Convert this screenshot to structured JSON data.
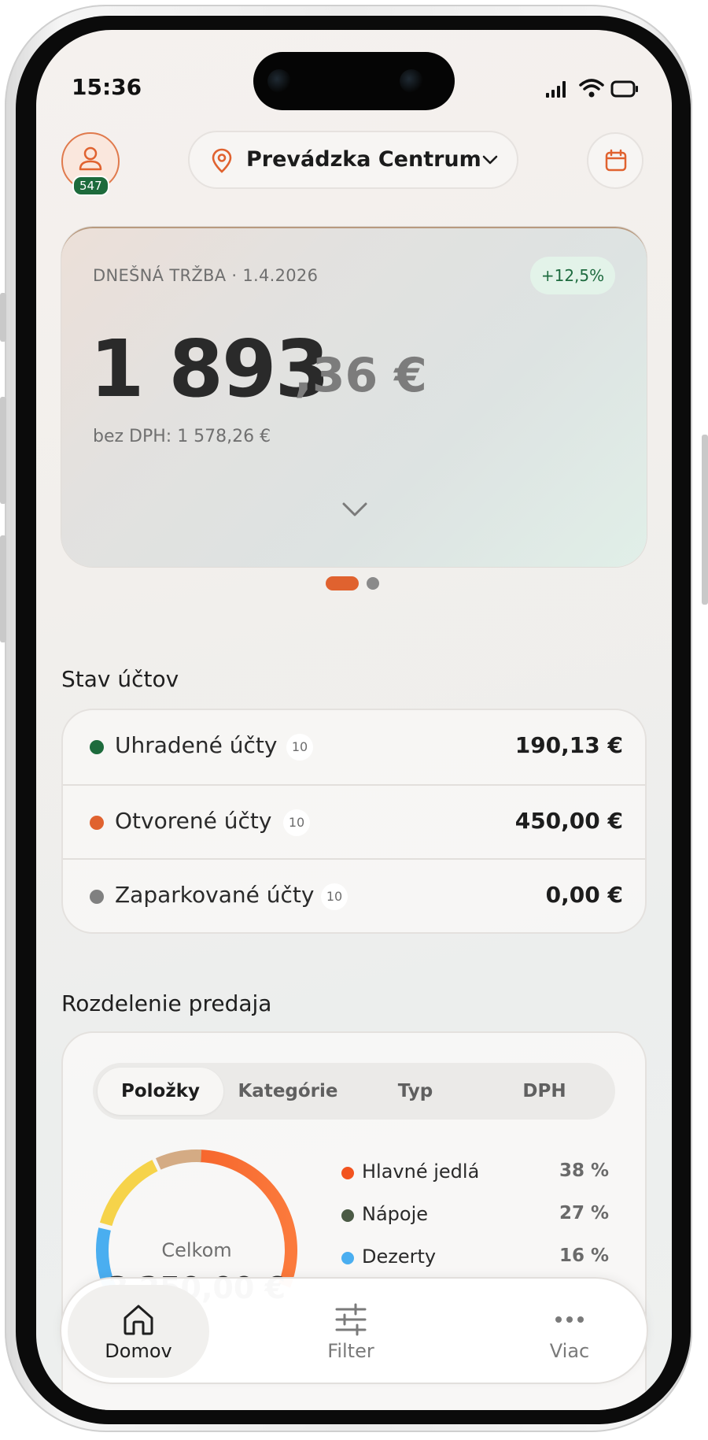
{
  "status_bar": {
    "time": "15:36"
  },
  "header": {
    "avatar_badge": "547",
    "location": "Prevádzka Centrum"
  },
  "revenue": {
    "label": "DNEŠNÁ TRŽBA · 1.4.2026",
    "change": "+12,5%",
    "amount_main": "1 893",
    "amount_cents": ",36 €",
    "net": "bez DPH: 1 578,26 €"
  },
  "accounts": {
    "title": "Stav účtov",
    "rows": [
      {
        "label": "Uhradené účty",
        "count": "10",
        "value": "190,13 €",
        "color": "#1d6b3c"
      },
      {
        "label": "Otvorené účty",
        "count": "10",
        "value": "450,00 €",
        "color": "#e0622f"
      },
      {
        "label": "Zaparkované účty",
        "count": "10",
        "value": "0,00 €",
        "color": "#808080"
      }
    ]
  },
  "sales": {
    "title": "Rozdelenie predaja",
    "tabs": [
      "Položky",
      "Kategórie",
      "Typ",
      "DPH"
    ],
    "donut_label": "Celkom",
    "donut_total": "3 250,00 €",
    "legend": [
      {
        "name": "Hlavné jedlá",
        "pct": "38 %",
        "color": "#f2531f"
      },
      {
        "name": "Nápoje",
        "pct": "27 %",
        "color": "#4b5a45"
      },
      {
        "name": "Dezerty",
        "pct": "16 %",
        "color": "#4aaef0"
      }
    ]
  },
  "tabbar": {
    "home": "Domov",
    "filter": "Filter",
    "more": "Viac"
  },
  "colors": {
    "accent": "#e0622f",
    "success": "#1d6b3c"
  }
}
